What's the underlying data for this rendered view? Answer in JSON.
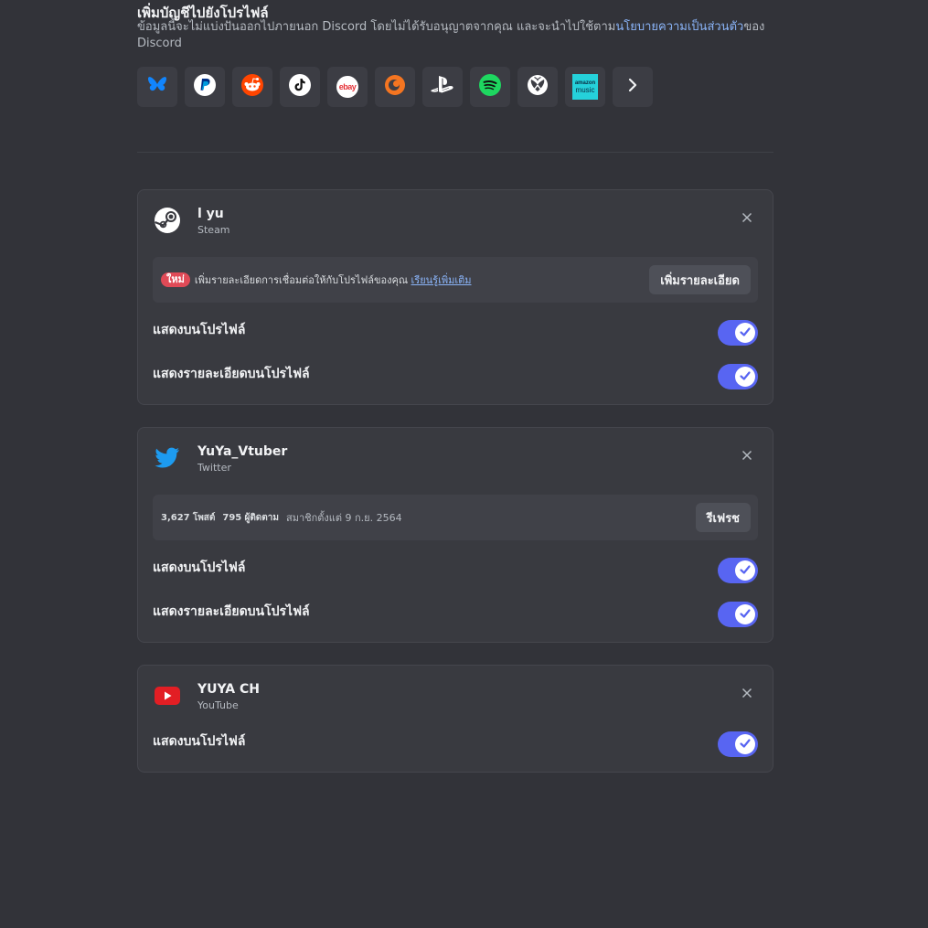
{
  "add_section": {
    "title": "เพิ่มบัญชีไปยังโปรไฟล์",
    "desc_prefix": "ข้อมูลนี้จะไม่แบ่งปันออกไปภายนอก Discord โดยไม่ได้รับอนุญาตจากคุณ และจะนำไปใช้ตาม",
    "policy_link": "นโยบายความเป็นส่วนตัว",
    "desc_suffix": "ของ Discord",
    "services": [
      {
        "icon": "bluesky-icon"
      },
      {
        "icon": "paypal-icon"
      },
      {
        "icon": "reddit-icon"
      },
      {
        "icon": "tiktok-icon"
      },
      {
        "icon": "ebay-icon",
        "text": "ebay"
      },
      {
        "icon": "crunchyroll-icon"
      },
      {
        "icon": "playstation-icon"
      },
      {
        "icon": "spotify-icon"
      },
      {
        "icon": "xbox-icon"
      },
      {
        "icon": "amazon-music-icon",
        "text_top": "amazon",
        "text_bottom": "music"
      },
      {
        "icon": "chevron-right-icon"
      }
    ]
  },
  "connections": [
    {
      "name": "l yu",
      "type": "Steam",
      "icon": "steam-icon",
      "banner": {
        "badge": "ใหม่",
        "text": "เพิ่มรายละเอียดการเชื่อมต่อให้กับโปรไฟล์ของคุณ",
        "link": "เรียนรู้เพิ่มเติม",
        "button": "เพิ่มรายละเอียด"
      },
      "toggles": [
        {
          "label": "แสดงบนโปรไฟล์",
          "on": true
        },
        {
          "label": "แสดงรายละเอียดบนโปรไฟล์",
          "on": true
        }
      ]
    },
    {
      "name": "YuYa_Vtuber",
      "type": "Twitter",
      "icon": "twitter-icon",
      "stats": {
        "posts_count": "3,627",
        "posts_label": "โพสต์",
        "followers_count": "795",
        "followers_label": "ผู้ติดตาม",
        "member_since": "สมาชิกตั้งแต่ 9 ก.ย. 2564",
        "button": "รีเฟรช"
      },
      "toggles": [
        {
          "label": "แสดงบนโปรไฟล์",
          "on": true
        },
        {
          "label": "แสดงรายละเอียดบนโปรไฟล์",
          "on": true
        }
      ]
    },
    {
      "name": "YUYA CH",
      "type": "YouTube",
      "icon": "youtube-icon",
      "toggles": [
        {
          "label": "แสดงบนโปรไฟล์",
          "on": true
        }
      ]
    }
  ],
  "colors": {
    "background": "#323339",
    "card": "#393a40",
    "toggle_on": "#5865f2",
    "link": "#8ab4f8",
    "new_badge": "#e04a57"
  }
}
